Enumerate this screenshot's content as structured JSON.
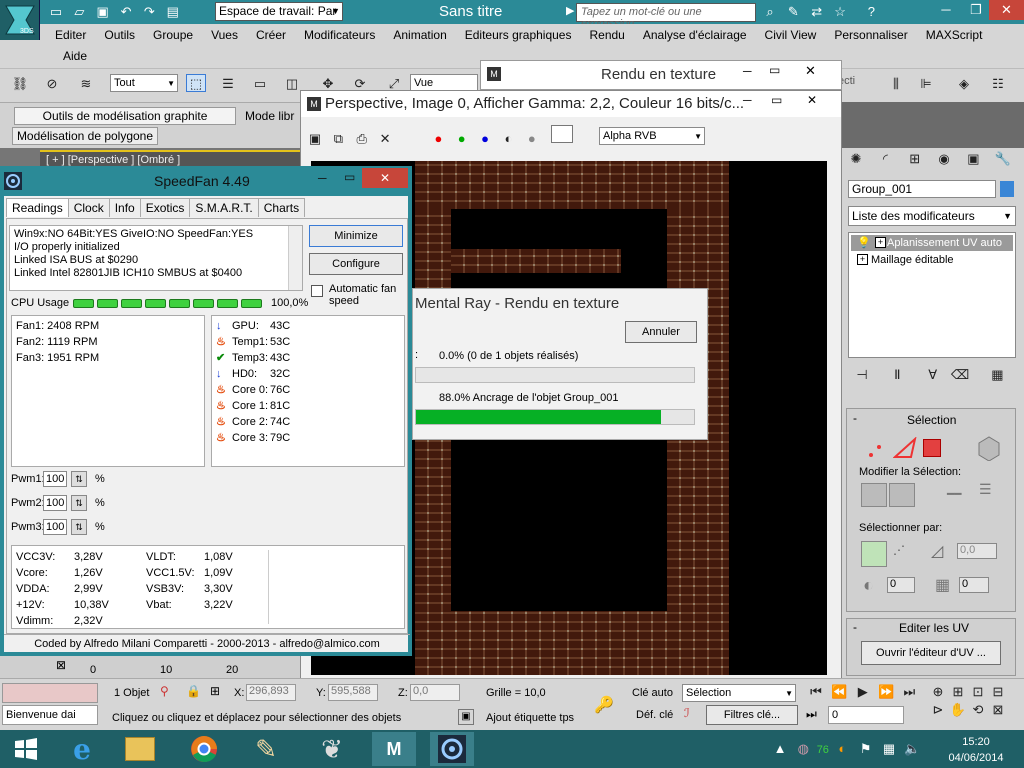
{
  "max": {
    "title": "Sans titre",
    "logo_label": "3DS",
    "workspace_label": "Espace de travail: Par",
    "search_placeholder": "Tapez un mot-clé ou une expression",
    "menus": [
      "Editer",
      "Outils",
      "Groupe",
      "Vues",
      "Créer",
      "Modificateurs",
      "Animation",
      "Editeurs graphiques",
      "Rendu",
      "Analyse d'éclairage",
      "Civil View",
      "Personnaliser",
      "MAXScript"
    ],
    "menu_help": "Aide",
    "selection_filter": "Tout",
    "view_select": "Vue",
    "ribbon_tabs": [
      "Outils de modélisation graphite",
      "Mode libr"
    ],
    "ribbon_sub": "Modélisation de polygone",
    "viewport_label": "[ + ] [Perspective ] [Ombré ]",
    "object_name": "Group_001",
    "modifier_list": "Liste des modificateurs",
    "stack": [
      "Aplanissement UV auto",
      "Maillage éditable"
    ],
    "panel_selection": "Sélection",
    "panel_modify_sel": "Modifier la Sélection:",
    "panel_select_by": "Sélectionner par:",
    "spin_a": "0,0",
    "spin_b": "0",
    "spin_c": "0",
    "panel_edit_uv": "Editer les UV",
    "open_uv_editor": "Ouvrir l'éditeur d'UV ...",
    "status_objects": "1 Objet",
    "coord_x_label": "X:",
    "coord_x": "296,893",
    "coord_y_label": "Y:",
    "coord_y": "595,588",
    "coord_z_label": "Z:",
    "coord_z": "0,0",
    "grid": "Grille = 10,0",
    "prompt_welcome": "Bienvenue dai",
    "prompt_hint": "Cliquez ou cliquez et déplacez pour sélectionner des objets",
    "add_tag": "Ajout étiquette tps",
    "key_auto": "Clé auto",
    "key_selection": "Sélection",
    "def_key": "Déf. clé",
    "key_filters": "Filtres clé...",
    "frame_value": "0",
    "timeline_ticks": [
      "0",
      "10",
      "20"
    ]
  },
  "render_tex": {
    "title": "Rendu en texture",
    "partial_select": "ecti"
  },
  "frame_window": {
    "title": "Perspective, Image 0, Afficher Gamma: 2,2, Couleur 16 bits/c...",
    "channel": "Alpha RVB"
  },
  "mental_ray": {
    "title": "Mental Ray - Rendu en texture",
    "cancel": "Annuler",
    "line1": "0.0% (0 de 1 objets réalisés)",
    "progress1": 0,
    "line2": "88.0% Ancrage de l'objet Group_001",
    "progress2": 88
  },
  "speedfan": {
    "title": "SpeedFan 4.49",
    "tabs": [
      "Readings",
      "Clock",
      "Info",
      "Exotics",
      "S.M.A.R.T.",
      "Charts"
    ],
    "log": [
      "Win9x:NO  64Bit:YES  GiveIO:NO  SpeedFan:YES",
      "I/O properly initialized",
      "Linked ISA BUS at $0290",
      "Linked Intel 82801JIB ICH10 SMBUS at $0400"
    ],
    "minimize": "Minimize",
    "configure": "Configure",
    "auto_fan": "Automatic fan speed",
    "cpu_usage_label": "CPU Usage",
    "cpu_usage_value": "100,0%",
    "fans": [
      "Fan1: 2408 RPM",
      "Fan2: 1119 RPM",
      "Fan3: 1951 RPM"
    ],
    "temps": [
      {
        "name": "GPU:",
        "value": "43C"
      },
      {
        "name": "Temp1:",
        "value": "53C"
      },
      {
        "name": "Temp3:",
        "value": "43C"
      },
      {
        "name": "HD0:",
        "value": "32C"
      },
      {
        "name": "Core 0:",
        "value": "76C"
      },
      {
        "name": "Core 1:",
        "value": "81C"
      },
      {
        "name": "Core 2:",
        "value": "74C"
      },
      {
        "name": "Core 3:",
        "value": "79C"
      }
    ],
    "pwm": [
      {
        "label": "Pwm1:",
        "value": "100"
      },
      {
        "label": "Pwm2:",
        "value": "100"
      },
      {
        "label": "Pwm3:",
        "value": "100"
      }
    ],
    "pct": "%",
    "volts_left": [
      {
        "name": "VCC3V:",
        "value": "3,28V"
      },
      {
        "name": "Vcore:",
        "value": "1,26V"
      },
      {
        "name": "VDDA:",
        "value": "2,99V"
      },
      {
        "name": "+12V:",
        "value": "10,38V"
      },
      {
        "name": "Vdimm:",
        "value": "2,32V"
      }
    ],
    "volts_right": [
      {
        "name": "VLDT:",
        "value": "1,08V"
      },
      {
        "name": "VCC1.5V:",
        "value": "1,09V"
      },
      {
        "name": "VSB3V:",
        "value": "3,30V"
      },
      {
        "name": "Vbat:",
        "value": "3,22V"
      }
    ],
    "footer": "Coded by Alfredo Milani Comparetti - 2000-2013 - alfredo@almico.com"
  },
  "taskbar": {
    "time": "15:20",
    "date": "04/06/2014",
    "tray_num": "76"
  }
}
